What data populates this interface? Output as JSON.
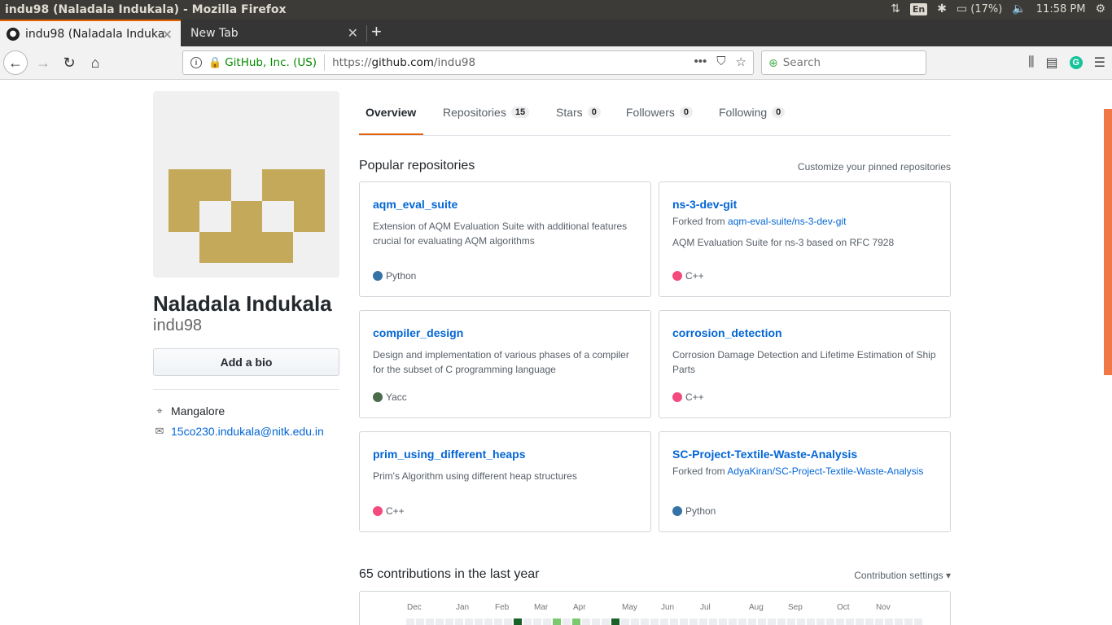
{
  "os": {
    "window_title": "indu98 (Naladala Indukala) - Mozilla Firefox",
    "lang": "En",
    "battery": "(17%)",
    "time": "11:58 PM"
  },
  "browser": {
    "tabs": [
      {
        "label": "indu98 (Naladala Induka",
        "active": true
      },
      {
        "label": "New Tab",
        "active": false
      }
    ],
    "identity": "GitHub, Inc. (US)",
    "url_scheme": "https://",
    "url_host": "github.com",
    "url_path": "/indu98",
    "search_placeholder": "Search"
  },
  "profile": {
    "full_name": "Naladala Indukala",
    "login": "indu98",
    "bio_button": "Add a bio",
    "location": "Mangalore",
    "email": "15co230.indukala@nitk.edu.in",
    "avatar_color": "#c4a95a"
  },
  "nav_tabs": [
    {
      "label": "Overview",
      "count": ""
    },
    {
      "label": "Repositories",
      "count": "15"
    },
    {
      "label": "Stars",
      "count": "0"
    },
    {
      "label": "Followers",
      "count": "0"
    },
    {
      "label": "Following",
      "count": "0"
    }
  ],
  "popular": {
    "title": "Popular repositories",
    "customize": "Customize your pinned repositories",
    "repos": [
      {
        "name": "aqm_eval_suite",
        "fork_prefix": "",
        "fork_source": "",
        "description": "Extension of AQM Evaluation Suite with additional features crucial for evaluating AQM algorithms",
        "language": "Python",
        "lang_color": "#3572A5"
      },
      {
        "name": "ns-3-dev-git",
        "fork_prefix": "Forked from ",
        "fork_source": "aqm-eval-suite/ns-3-dev-git",
        "description": "AQM Evaluation Suite for ns-3 based on RFC 7928",
        "language": "C++",
        "lang_color": "#f34b7d"
      },
      {
        "name": "compiler_design",
        "fork_prefix": "",
        "fork_source": "",
        "description": "Design and implementation of various phases of a compiler for the subset of C programming language",
        "language": "Yacc",
        "lang_color": "#4b6c4b"
      },
      {
        "name": "corrosion_detection",
        "fork_prefix": "",
        "fork_source": "",
        "description": "Corrosion Damage Detection and Lifetime Estimation of Ship Parts",
        "language": "C++",
        "lang_color": "#f34b7d"
      },
      {
        "name": "prim_using_different_heaps",
        "fork_prefix": "",
        "fork_source": "",
        "description": "Prim's Algorithm using different heap structures",
        "language": "C++",
        "lang_color": "#f34b7d"
      },
      {
        "name": "SC-Project-Textile-Waste-Analysis",
        "fork_prefix": "Forked from ",
        "fork_source": "AdyaKiran/SC-Project-Textile-Waste-Analysis",
        "description": "",
        "language": "Python",
        "lang_color": "#3572A5"
      }
    ]
  },
  "contributions": {
    "title": "65 contributions in the last year",
    "settings": "Contribution settings",
    "months": [
      "Dec",
      "Jan",
      "Feb",
      "Mar",
      "Apr",
      "May",
      "Jun",
      "Jul",
      "Aug",
      "Sep",
      "Oct",
      "Nov"
    ],
    "colors": {
      "empty": "#ebedf0",
      "light": "#7bc96f",
      "dark": "#196127"
    }
  }
}
